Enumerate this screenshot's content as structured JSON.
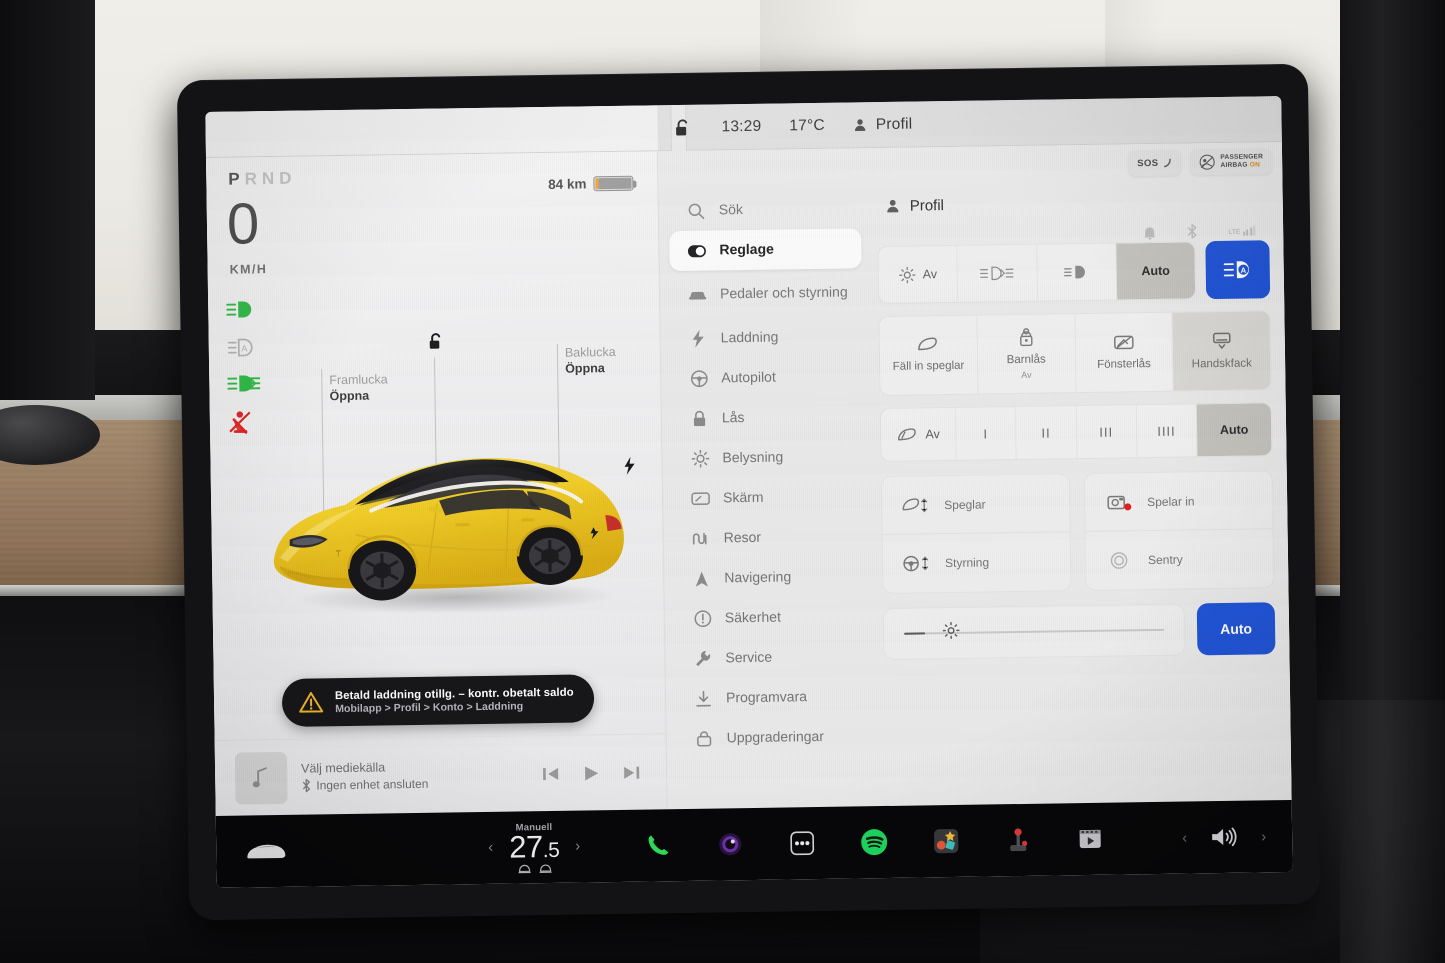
{
  "topbar": {
    "lock_icon": "lock-unlocked-icon",
    "time": "13:29",
    "temperature": "17°C",
    "profile_label": "Profil",
    "profile_icon": "person-icon"
  },
  "drive_panel": {
    "gear_selector": {
      "letters": [
        "P",
        "R",
        "N",
        "D"
      ],
      "active": "P"
    },
    "speed_value": "0",
    "speed_unit": "KM/H",
    "range_text": "84 km",
    "battery_percent": 9,
    "telltales": [
      {
        "name": "high-beam-icon",
        "color": "#2cb742"
      },
      {
        "name": "auto-high-beam-icon",
        "color": "#b0b0b0"
      },
      {
        "name": "fog-light-icon",
        "color": "#2cb742"
      },
      {
        "name": "seatbelt-warning-icon",
        "color": "#e02020"
      }
    ],
    "front_trunk": {
      "label": "Framlucka",
      "action": "Öppna"
    },
    "rear_trunk": {
      "label": "Baklucka",
      "action": "Öppna"
    },
    "lock_status_icon": "lock-open-icon",
    "charge_port_icon": "charge-bolt-icon",
    "vehicle_color": "#f2cf2e",
    "toast": {
      "icon": "warning-triangle-icon",
      "title": "Betald laddning otillg. – kontr. obetalt saldo",
      "subtitle": "Mobilapp > Profil > Konto > Laddning"
    },
    "media": {
      "art_icon": "music-note-icon",
      "line1": "Välj mediekälla",
      "bluetooth_icon": "bluetooth-icon",
      "line2": "Ingen enhet ansluten",
      "controls": [
        "prev-track-button",
        "play-button",
        "next-track-button"
      ]
    }
  },
  "badges": {
    "sos_label": "SOS",
    "airbag_line1": "PASSENGER",
    "airbag_line2": "AIRBAG",
    "airbag_state": "ON"
  },
  "sidebar": {
    "items": [
      {
        "label": "Sök",
        "icon": "search-icon",
        "active": false,
        "two_line": false
      },
      {
        "label": "Reglage",
        "icon": "toggle-icon",
        "active": true,
        "two_line": false
      },
      {
        "label": "Pedaler och styrning",
        "icon": "car-icon",
        "active": false,
        "two_line": true
      },
      {
        "label": "Laddning",
        "icon": "bolt-icon",
        "active": false,
        "two_line": false
      },
      {
        "label": "Autopilot",
        "icon": "steering-wheel-icon",
        "active": false,
        "two_line": false
      },
      {
        "label": "Lås",
        "icon": "lock-icon",
        "active": false,
        "two_line": false
      },
      {
        "label": "Belysning",
        "icon": "sun-icon",
        "active": false,
        "two_line": false
      },
      {
        "label": "Skärm",
        "icon": "display-icon",
        "active": false,
        "two_line": false
      },
      {
        "label": "Resor",
        "icon": "trips-icon",
        "active": false,
        "two_line": false
      },
      {
        "label": "Navigering",
        "icon": "navigation-arrow-icon",
        "active": false,
        "two_line": false
      },
      {
        "label": "Säkerhet",
        "icon": "alert-circle-icon",
        "active": false,
        "two_line": false
      },
      {
        "label": "Service",
        "icon": "wrench-icon",
        "active": false,
        "two_line": false
      },
      {
        "label": "Programvara",
        "icon": "download-icon",
        "active": false,
        "two_line": false
      },
      {
        "label": "Uppgraderingar",
        "icon": "bag-icon",
        "active": false,
        "two_line": false
      }
    ]
  },
  "content": {
    "header_title": "Profil",
    "header_icon": "person-icon",
    "status_icons": [
      "bell-icon",
      "bluetooth-off-icon",
      "lte-signal-icon"
    ],
    "lights_row": {
      "cells": [
        {
          "label": "Av",
          "icon": "lights-off-icon",
          "selected": false
        },
        {
          "label": "",
          "icon": "parking-lights-icon",
          "selected": false
        },
        {
          "label": "",
          "icon": "low-beam-icon",
          "selected": false
        },
        {
          "label": "Auto",
          "icon": "",
          "selected": true
        }
      ],
      "action_button_icon": "high-beam-auto-icon",
      "action_button_color": "#2154d6"
    },
    "quick_grid": [
      {
        "label": "Fäll in speglar",
        "sub": "",
        "icon": "mirror-fold-icon",
        "selected": false
      },
      {
        "label": "Barnlås",
        "sub": "Av",
        "icon": "child-lock-icon",
        "selected": false
      },
      {
        "label": "Fönsterlås",
        "sub": "",
        "icon": "window-lock-icon",
        "selected": false
      },
      {
        "label": "Handskfack",
        "sub": "",
        "icon": "glovebox-icon",
        "selected": true
      }
    ],
    "wipers_row": {
      "cells": [
        {
          "label": "Av",
          "icon": "wiper-icon",
          "selected": false
        },
        {
          "label": "I",
          "icon": "",
          "selected": false
        },
        {
          "label": "II",
          "icon": "",
          "selected": false
        },
        {
          "label": "III",
          "icon": "",
          "selected": false
        },
        {
          "label": "IIII",
          "icon": "",
          "selected": false
        },
        {
          "label": "Auto",
          "icon": "",
          "selected": true
        }
      ]
    },
    "cards": [
      [
        {
          "label": "Speglar",
          "icon": "mirror-adjust-icon",
          "recording": false
        },
        {
          "label": "Styrning",
          "icon": "steering-adjust-icon",
          "recording": false
        }
      ],
      [
        {
          "label": "Spelar in",
          "icon": "dashcam-icon",
          "recording": true
        },
        {
          "label": "Sentry",
          "icon": "sentry-icon",
          "recording": false
        }
      ]
    ],
    "brightness": {
      "icon": "brightness-icon",
      "value_percent": 18,
      "auto_label": "Auto",
      "auto_color": "#2154d6"
    }
  },
  "taskbar": {
    "car_icon": "car-front-icon",
    "climate": {
      "mode": "Manuell",
      "temperature": "27.5",
      "temp_int": "27",
      "temp_dec": ".5",
      "left_arrow": "‹",
      "right_arrow": "›",
      "seat_icons": [
        "seat-heater-left-icon",
        "seat-heater-right-icon"
      ]
    },
    "apps": [
      {
        "name": "phone-app-icon",
        "color": "#2ee05a"
      },
      {
        "name": "camera-app-icon",
        "color": "#8b4fd1"
      },
      {
        "name": "more-apps-icon",
        "color": "#ffffff"
      },
      {
        "name": "spotify-app-icon",
        "color": "#1ed760"
      },
      {
        "name": "toybox-app-icon",
        "color": "#f5b942"
      },
      {
        "name": "arcade-app-icon",
        "color": "#e03b3b"
      },
      {
        "name": "theater-app-icon",
        "color": "#d8d8d8"
      }
    ],
    "volume": {
      "icon": "volume-icon",
      "left_arrow": "‹",
      "right_arrow": "›"
    }
  }
}
